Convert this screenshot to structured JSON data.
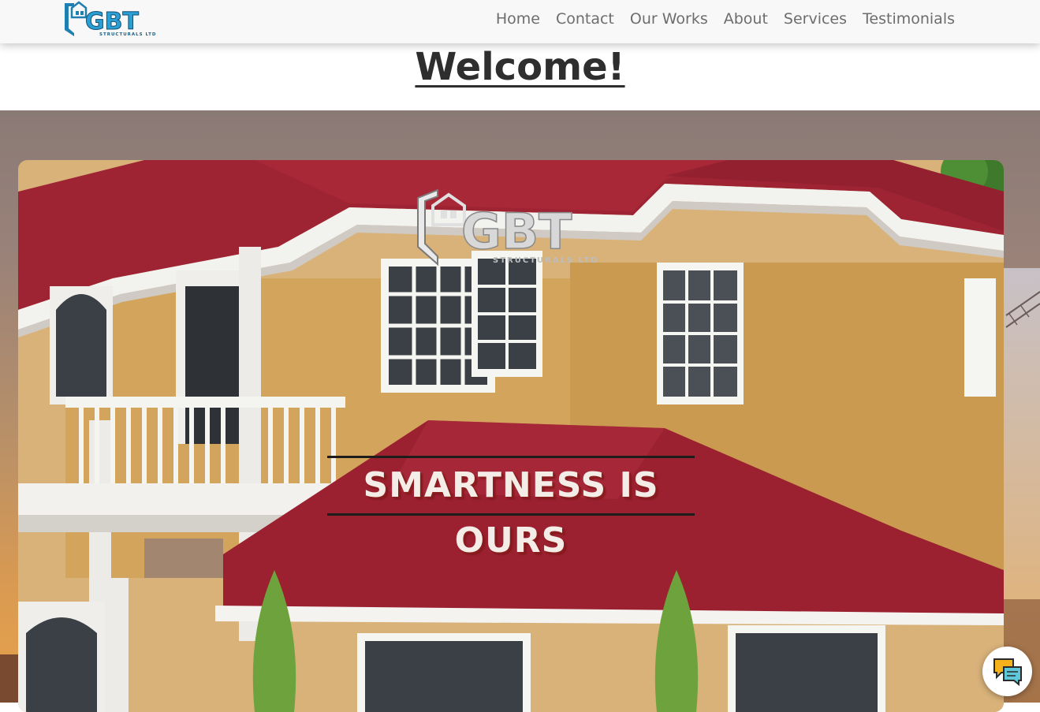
{
  "navbar": {
    "brand_name": "GBT",
    "brand_subtitle": "STRUCTURALS LTD",
    "links": [
      {
        "label": "Home"
      },
      {
        "label": "Contact"
      },
      {
        "label": "Our Works"
      },
      {
        "label": "About"
      },
      {
        "label": "Services"
      },
      {
        "label": "Testimonials"
      }
    ]
  },
  "welcome": {
    "title": "Welcome!"
  },
  "hero": {
    "logo_name": "GBT",
    "logo_subtitle": "STRUCTURALS LTD",
    "tagline": "SMARTNESS IS OURS"
  },
  "chat": {
    "icon": "chat-bubbles-icon"
  },
  "colors": {
    "brand_blue": "#2a9fd6",
    "roof_red": "#9e2433",
    "wall_ochre": "#d7a85e",
    "tagline_shadow": "#8a1d1d"
  }
}
